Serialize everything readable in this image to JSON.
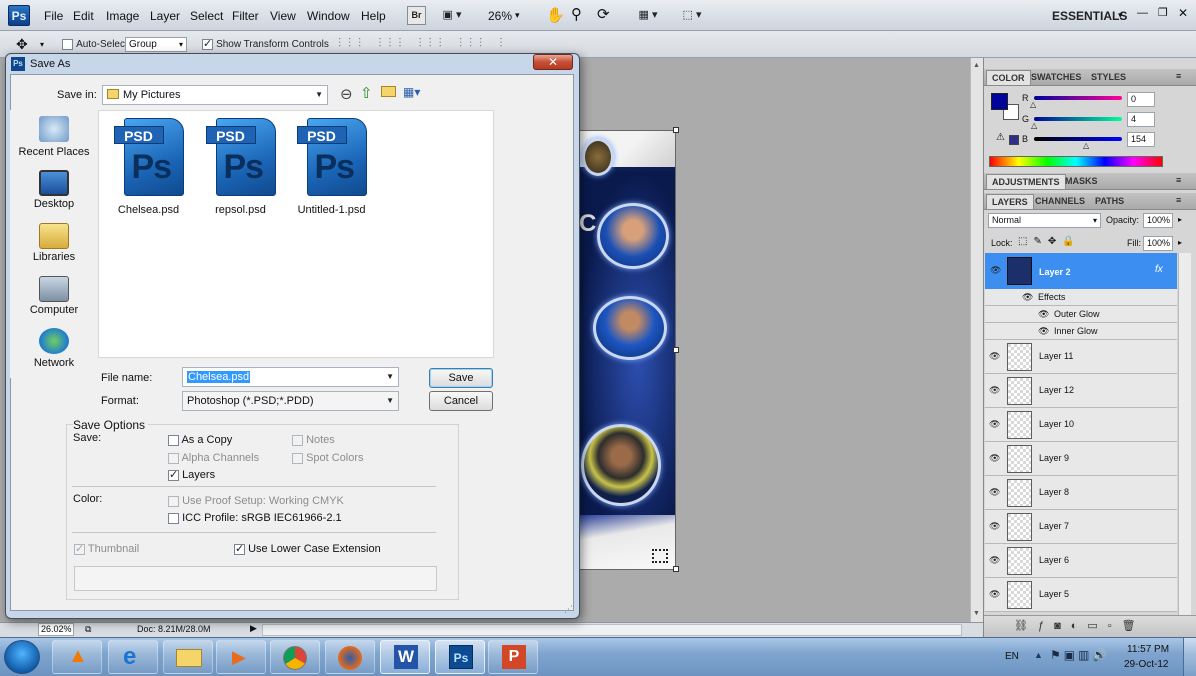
{
  "app": {
    "logo": "Ps",
    "menu": [
      "File",
      "Edit",
      "Image",
      "Layer",
      "Select",
      "Filter",
      "View",
      "Window",
      "Help"
    ],
    "zoom": "26%",
    "workspace": "ESSENTIALS",
    "bridge_label": "Br"
  },
  "options": {
    "auto_select_label": "Auto-Select:",
    "auto_select_value": "Group",
    "transform_label": "Show Transform Controls"
  },
  "status": {
    "zoom": "26.02%",
    "doc": "Doc: 8.21M/28.0M"
  },
  "color_panel": {
    "tabs": [
      "COLOR",
      "SWATCHES",
      "STYLES"
    ],
    "r_label": "R",
    "g_label": "G",
    "b_label": "B",
    "r": "0",
    "g": "4",
    "b": "154",
    "foreground": "#00049a"
  },
  "adjust_panel": {
    "tabs": [
      "ADJUSTMENTS",
      "MASKS"
    ]
  },
  "layers_panel": {
    "tabs": [
      "LAYERS",
      "CHANNELS",
      "PATHS"
    ],
    "blend_mode": "Normal",
    "opacity_label": "Opacity:",
    "opacity": "100%",
    "lock_label": "Lock:",
    "fill_label": "Fill:",
    "fill": "100%",
    "active_layer": "Layer 2",
    "fx": "fx",
    "effects_label": "Effects",
    "effects": [
      "Outer Glow",
      "Inner Glow"
    ],
    "layers": [
      "Layer 11",
      "Layer 12",
      "Layer 10",
      "Layer 9",
      "Layer 8",
      "Layer 7",
      "Layer 6",
      "Layer 5"
    ]
  },
  "dialog": {
    "title": "Save As",
    "close": "✕",
    "save_in_label": "Save in:",
    "save_in_value": "My Pictures",
    "places": [
      "Recent Places",
      "Desktop",
      "Libraries",
      "Computer",
      "Network"
    ],
    "files": [
      {
        "name": "Chelsea.psd",
        "tag": "PSD",
        "glyph": "Ps"
      },
      {
        "name": "repsol.psd",
        "tag": "PSD",
        "glyph": "Ps"
      },
      {
        "name": "Untitled-1.psd",
        "tag": "PSD",
        "glyph": "Ps"
      }
    ],
    "file_name_label": "File name:",
    "file_name_value": "Chelsea.psd",
    "format_label": "Format:",
    "format_value": "Photoshop (*.PSD;*.PDD)",
    "save_button": "Save",
    "cancel_button": "Cancel",
    "save_options_title": "Save Options",
    "save_label": "Save:",
    "as_a_copy": "As a Copy",
    "notes": "Notes",
    "alpha_channels": "Alpha Channels",
    "spot_colors": "Spot Colors",
    "layers": "Layers",
    "color_label": "Color:",
    "use_proof": "Use Proof Setup:  Working CMYK",
    "icc_profile": "ICC Profile:  sRGB IEC61966-2.1",
    "thumbnail": "Thumbnail",
    "lower_case": "Use Lower Case Extension"
  },
  "taskbar": {
    "lang": "EN",
    "time": "11:57 PM",
    "date": "29-Oct-12"
  }
}
